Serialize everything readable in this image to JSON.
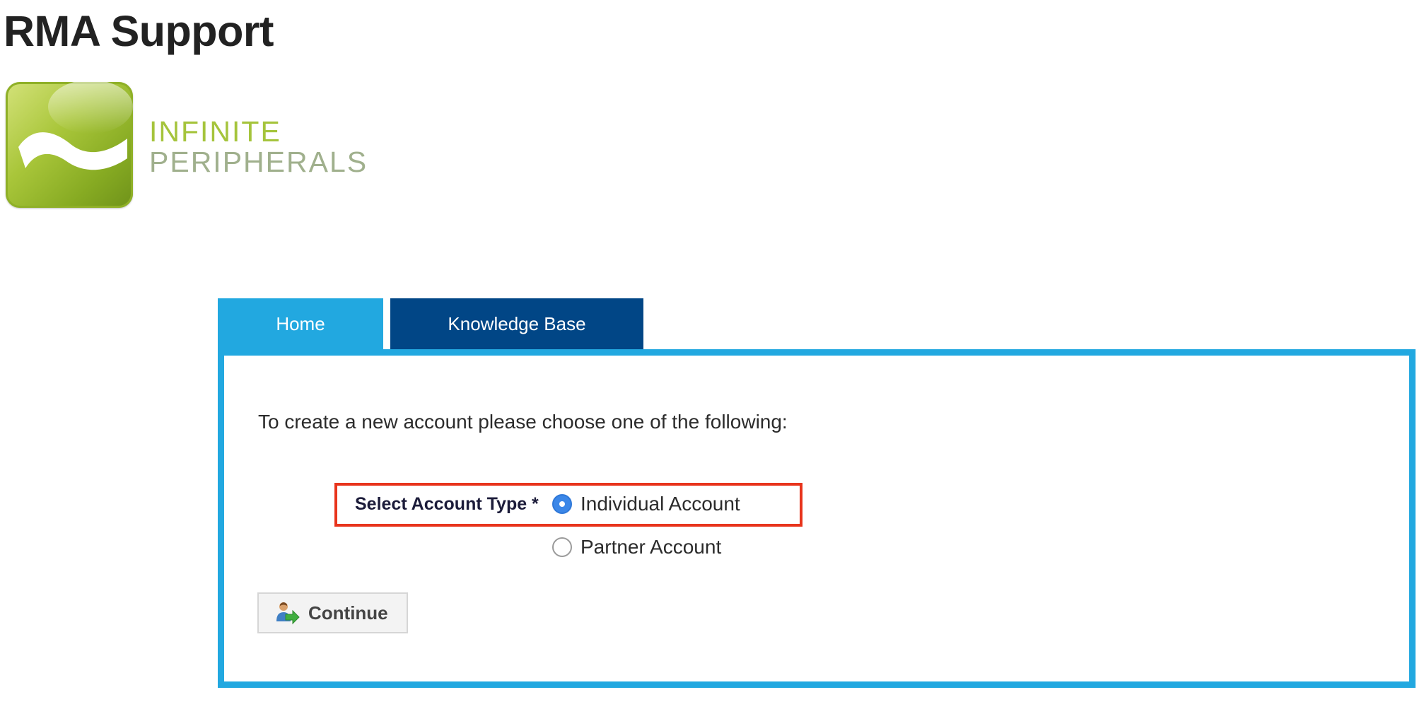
{
  "site": {
    "title": "RMA Support"
  },
  "logo": {
    "line1": "INFINITE",
    "line2": "PERIPHERALS",
    "icon": "wave-logo-icon"
  },
  "tabs": [
    {
      "label": "Home",
      "active": true,
      "color": "#22a8e0"
    },
    {
      "label": "Knowledge Base",
      "active": false,
      "color": "#014686"
    }
  ],
  "form": {
    "intro": "To create a new account please choose one of the following:",
    "account_type_label": "Select Account Type *",
    "options": [
      {
        "label": "Individual Account",
        "selected": true
      },
      {
        "label": "Partner Account",
        "selected": false
      }
    ],
    "continue_label": "Continue",
    "continue_icon": "user-arrow-icon",
    "highlight_color": "#e8341c"
  },
  "colors": {
    "accent": "#22a8e0",
    "dark_blue": "#014686",
    "logo_green": "#a5c43c"
  }
}
